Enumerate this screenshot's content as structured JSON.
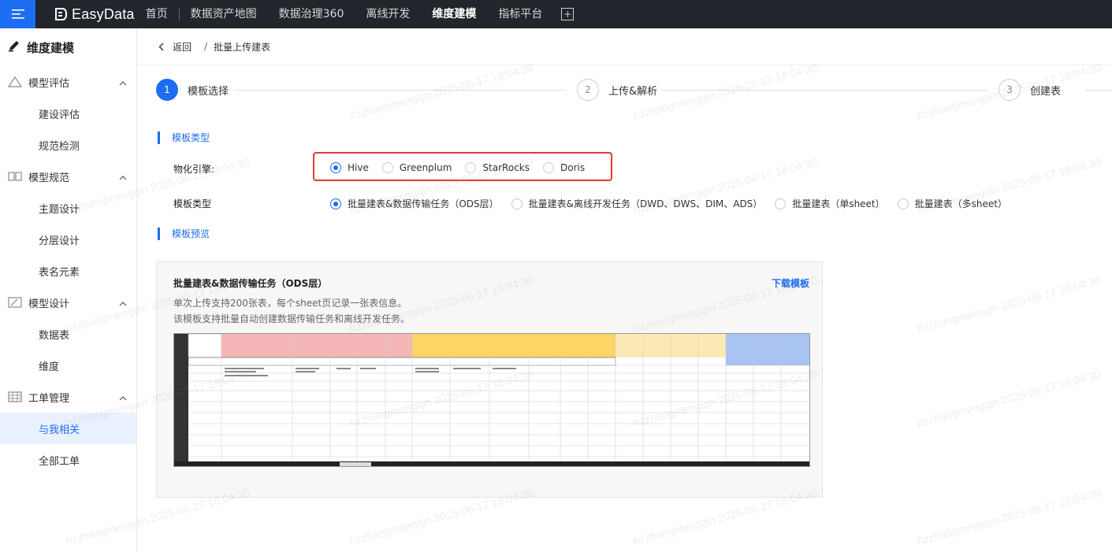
{
  "topbar": {
    "logo_text": "EasyData",
    "nav": [
      "首页",
      "数据资产地图",
      "数据治理360",
      "离线开发",
      "维度建模",
      "指标平台"
    ],
    "active_nav": "维度建模"
  },
  "sidebar": {
    "title": "维度建模",
    "groups": [
      {
        "label": "模型评估",
        "icon": "triangle-icon",
        "items": [
          "建设评估",
          "规范检测"
        ]
      },
      {
        "label": "模型规范",
        "icon": "book-icon",
        "items": [
          "主题设计",
          "分层设计",
          "表名元素"
        ]
      },
      {
        "label": "模型设计",
        "icon": "ruler-icon",
        "items": [
          "数据表",
          "维度"
        ]
      },
      {
        "label": "工单管理",
        "icon": "table-icon",
        "items": [
          "与我相关",
          "全部工单"
        ]
      }
    ],
    "active_item": "与我相关"
  },
  "breadcrumb": {
    "back": "返回",
    "sep": "/",
    "current": "批量上传建表"
  },
  "steps": [
    {
      "num": "1",
      "label": "模板选择"
    },
    {
      "num": "2",
      "label": "上传&解析"
    },
    {
      "num": "3",
      "label": "创建表"
    }
  ],
  "section1": {
    "title": "模板类型"
  },
  "engine": {
    "label": "物化引擎:",
    "options": [
      "Hive",
      "Greenplum",
      "StarRocks",
      "Doris"
    ],
    "selected": "Hive"
  },
  "template": {
    "label": "模板类型",
    "options": [
      "批量建表&数据传输任务（ODS层）",
      "批量建表&离线开发任务（DWD、DWS、DIM、ADS）",
      "批量建表（单sheet）",
      "批量建表（多sheet）"
    ],
    "selected": "批量建表&数据传输任务（ODS层）"
  },
  "section2": {
    "title": "模板预览"
  },
  "preview": {
    "title": "批量建表&数据传输任务（ODS层）",
    "download": "下载模板",
    "desc1": "单次上传支持200张表，每个sheet页记录一张表信息。",
    "desc2": "该模板支持批量自动创建数据传输任务和离线开发任务。"
  },
  "watermark": "hzzhangmengqin 2025-06-17 18:04:30",
  "colors": {
    "accent": "#1d6df2",
    "topbar": "#22252b",
    "highlight": "#e53935"
  }
}
